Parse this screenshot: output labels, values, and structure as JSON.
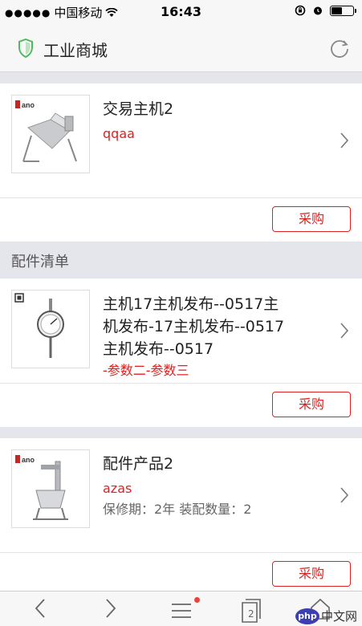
{
  "status_bar": {
    "carrier": "中国移动",
    "time": "16:43"
  },
  "header": {
    "title": "工业商城",
    "icons": [
      "shield-icon",
      "refresh-icon"
    ]
  },
  "main_product": {
    "name": "交易主机2",
    "subtitle": "qqaa",
    "buy_label": "采购"
  },
  "accessories": {
    "section_title": "配件清单",
    "items": [
      {
        "name_lines": [
          "主机17主机发布--0517主",
          "机发布-17主机发布--0517",
          "主机发布--0517"
        ],
        "subtitle": "-参数二-参数三",
        "buy_label": "采购"
      },
      {
        "name": "配件产品2",
        "subtitle": "azas",
        "meta": "保修期：2年   装配数量：2",
        "buy_label": "采购"
      }
    ]
  },
  "toolbar": {
    "tab_count": "2",
    "watermark": "中文网",
    "watermark_badge": "php"
  },
  "colors": {
    "accent": "#dd2222",
    "shield_green": "#4cbb5e",
    "background": "#ececf1"
  }
}
